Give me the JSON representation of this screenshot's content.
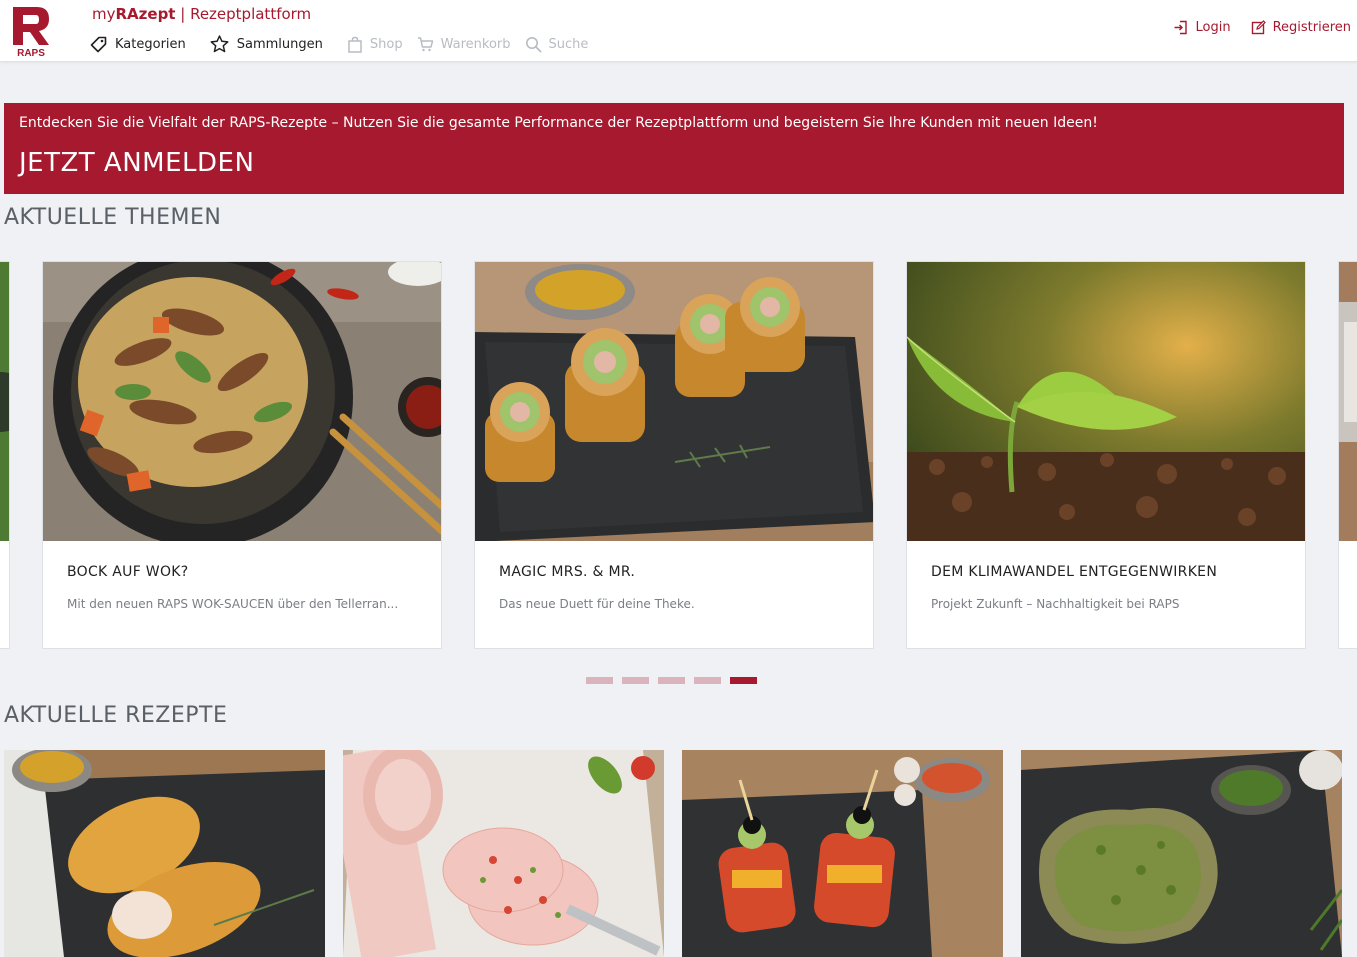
{
  "header": {
    "logo_text": "RAPS",
    "brand_prefix": "my",
    "brand_bold": "RAzept",
    "brand_suffix": " | Rezeptplattform",
    "nav": [
      {
        "label": "Kategorien",
        "icon": "tag-icon"
      },
      {
        "label": "Sammlungen",
        "icon": "star-icon"
      },
      {
        "label": "Shop",
        "icon": "shopping-bag-icon"
      },
      {
        "label": "Warenkorb",
        "icon": "cart-icon"
      },
      {
        "label": "Suche",
        "icon": "search-icon"
      }
    ],
    "login": "Login",
    "register": "Registrieren"
  },
  "banner": {
    "text": "Entdecken Sie die Vielfalt der RAPS-Rezepte – Nutzen Sie die gesamte Performance der Rezeptplattform und begeistern Sie Ihre Kunden mit neuen Ideen!",
    "cta": "JETZT ANMELDEN"
  },
  "themes": {
    "title": "AKTUELLE THEMEN",
    "cards": [
      {
        "title": "BOCK AUF WOK?",
        "subtitle": "Mit den neuen RAPS WOK-SAUCEN über den Tellerran..."
      },
      {
        "title": "MAGIC MRS. & MR.",
        "subtitle": "Das neue Duett für deine Theke."
      },
      {
        "title": "DEM KLIMAWANDEL ENTGEGENWIRKEN",
        "subtitle": "Projekt Zukunft – Nachhaltigkeit bei RAPS"
      }
    ],
    "pager_count": 5,
    "pager_active": 5
  },
  "recipes": {
    "title": "AKTUELLE REZEPTE"
  },
  "colors": {
    "brand": "#a6192e",
    "pager_inactive": "#dbb3bc",
    "background": "#eff1f4"
  }
}
